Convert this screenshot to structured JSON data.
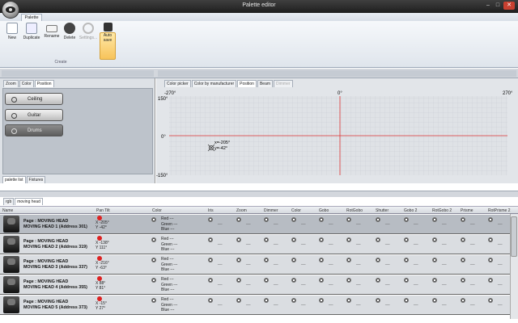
{
  "window": {
    "title": "Palette editor",
    "min": "–",
    "max": "□",
    "close": "✕"
  },
  "ribbon": {
    "tab": "Palette",
    "group": "Create",
    "buttons": [
      {
        "label": "New",
        "icon": "new-icon"
      },
      {
        "label": "Duplicate",
        "icon": "duplicate-icon"
      },
      {
        "label": "Rename",
        "icon": "rename-icon"
      },
      {
        "label": "Delete",
        "icon": "delete-icon"
      },
      {
        "label": "Settings...",
        "icon": "settings-icon"
      }
    ],
    "autosave": "Auto save"
  },
  "left": {
    "tabs": [
      "Zoom",
      "Color",
      "Position"
    ],
    "palettes": [
      "Ceiling",
      "Guitar",
      "Drums"
    ],
    "bottom_tabs": [
      "palette list",
      "Fixtures"
    ]
  },
  "right": {
    "tabs": [
      "Color picker",
      "Color by manufacturer",
      "Position",
      "Beam",
      "Dimmer"
    ],
    "axis": {
      "x_left": "-270°",
      "x_mid": "0°",
      "x_right": "270°",
      "y_top": "150°",
      "y_mid": "0°",
      "y_bottom": "-150°"
    },
    "marker": {
      "x_label": "x=-205°",
      "y_label": "y=-42°"
    }
  },
  "lower": {
    "tabs": [
      "rgb",
      "moving head"
    ],
    "columns": [
      "Name",
      "Pan Tilt",
      "Color",
      "Iris",
      "Zoom",
      "Dimmer",
      "Color",
      "Gobo",
      "RotGobo",
      "Shutter",
      "Gobo 2",
      "RotGobo 2",
      "Prisme",
      "RotPrisme 2"
    ],
    "color_labels": [
      "Red ---",
      "Green ---",
      "Blue ---"
    ],
    "dash": "__",
    "rows": [
      {
        "page": "Page : MOVING HEAD",
        "name": "MOVING HEAD 1 (Address 301)",
        "x": "X -205°",
        "y": "Y -42°"
      },
      {
        "page": "Page : MOVING HEAD",
        "name": "MOVING HEAD 2 (Address 319)",
        "x": "X -138°",
        "y": "Y 111°"
      },
      {
        "page": "Page : MOVING HEAD",
        "name": "MOVING HEAD 3 (Address 337)",
        "x": "X -216°",
        "y": "Y -63°"
      },
      {
        "page": "Page : MOVING HEAD",
        "name": "MOVING HEAD 4 (Address 355)",
        "x": "X 88°",
        "y": "Y 81°"
      },
      {
        "page": "Page : MOVING HEAD",
        "name": "MOVING HEAD 5 (Address 373)",
        "x": "X -15°",
        "y": "Y 27°"
      }
    ]
  }
}
